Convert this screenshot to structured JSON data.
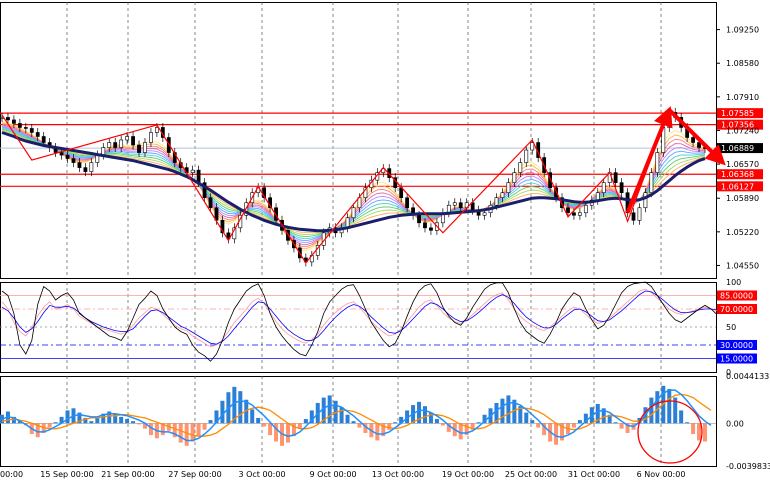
{
  "colors": {
    "background": "#ffffff",
    "level_line": "#ff0000",
    "current_price_line": "#b0c4de",
    "ma_thick": "#1a1f6b",
    "osc_blue": "#1e90ff",
    "osc_orange": "#ff8c00",
    "hist_positive": "#2b7fd4",
    "hist_negative": "#ff9470",
    "stoch_upper": "#ff9999",
    "stoch_lower": "#0000ff"
  },
  "chart_data": [
    {
      "type": "line",
      "panel": "price",
      "y_ticks": [
        "1.09250",
        "1.08580",
        "1.07910",
        "1.07240",
        "1.06570",
        "1.05890",
        "1.05220",
        "1.04550"
      ],
      "ylim": [
        1.043,
        1.098
      ],
      "x_ticks": [
        "00:00",
        "15 Sep 00:00",
        "21 Sep 00:00",
        "27 Sep 00:00",
        "3 Oct 00:00",
        "9 Oct 00:00",
        "13 Oct 00:00",
        "19 Oct 00:00",
        "25 Oct 00:00",
        "31 Oct 00:00",
        "6 Nov 00:00"
      ],
      "levels": [
        {
          "label": "1.07585",
          "value": 1.07585
        },
        {
          "label": "1.07356",
          "value": 1.07356
        },
        {
          "label": "1.06368",
          "value": 1.06368
        },
        {
          "label": "1.06127",
          "value": 1.06127
        }
      ],
      "current_price": {
        "label": "1.06889",
        "value": 1.06889
      },
      "close": [
        1.075,
        1.0745,
        1.0738,
        1.073,
        1.0728,
        1.072,
        1.0712,
        1.07,
        1.069,
        1.068,
        1.0675,
        1.0668,
        1.066,
        1.065,
        1.0642,
        1.066,
        1.0675,
        1.069,
        1.07,
        1.069,
        1.0705,
        1.0712,
        1.0695,
        1.068,
        1.07,
        1.072,
        1.073,
        1.071,
        1.068,
        1.066,
        1.065,
        1.064,
        1.0645,
        1.062,
        1.059,
        1.057,
        1.0545,
        1.052,
        1.0508,
        1.053,
        1.0555,
        1.058,
        1.06,
        1.061,
        1.059,
        1.057,
        1.0545,
        1.0525,
        1.0505,
        1.049,
        1.047,
        1.0462,
        1.0475,
        1.0495,
        1.052,
        1.053,
        1.052,
        1.053,
        1.055,
        1.057,
        1.059,
        1.061,
        1.0625,
        1.064,
        1.0648,
        1.063,
        1.061,
        1.059,
        1.057,
        1.0555,
        1.054,
        1.053,
        1.0525,
        1.054,
        1.056,
        1.0575,
        1.058,
        1.057,
        1.058,
        1.0565,
        1.0555,
        1.056,
        1.0575,
        1.059,
        1.06,
        1.062,
        1.064,
        1.066,
        1.0685,
        1.07,
        1.067,
        1.064,
        1.061,
        1.059,
        1.057,
        1.056,
        1.0555,
        1.056,
        1.0575,
        1.0585,
        1.06,
        1.062,
        1.064,
        1.062,
        1.06,
        1.056,
        1.0545,
        1.057,
        1.06,
        1.064,
        1.068,
        1.073,
        1.076,
        1.075,
        1.073,
        1.071,
        1.07,
        1.069,
        1.0688
      ],
      "ma_slow": [
        1.072,
        1.0716,
        1.0712,
        1.0707,
        1.0703,
        1.07,
        1.0697,
        1.0694,
        1.0692,
        1.069,
        1.0688,
        1.0686,
        1.0684,
        1.0682,
        1.068,
        1.0678,
        1.0676,
        1.0674,
        1.0672,
        1.067,
        1.0668,
        1.0666,
        1.0664,
        1.0661,
        1.0658,
        1.0655,
        1.0652,
        1.0649,
        1.0646,
        1.0642,
        1.0637,
        1.0632,
        1.0626,
        1.0619,
        1.0612,
        1.0605,
        1.0597,
        1.0589,
        1.0581,
        1.0574,
        1.0567,
        1.0561,
        1.0555,
        1.055,
        1.0545,
        1.0541,
        1.0537,
        1.0534,
        1.0531,
        1.0529,
        1.0527,
        1.0526,
        1.0525,
        1.0524,
        1.0524,
        1.0525,
        1.0526,
        1.0528,
        1.053,
        1.0533,
        1.0536,
        1.0539,
        1.0542,
        1.0545,
        1.0548,
        1.0551,
        1.0553,
        1.0555,
        1.0556,
        1.0557,
        1.0558,
        1.0558,
        1.0558,
        1.0558,
        1.0558,
        1.0559,
        1.056,
        1.0561,
        1.0562,
        1.0563,
        1.0564,
        1.0566,
        1.0568,
        1.0571,
        1.0574,
        1.0577,
        1.058,
        1.0583,
        1.0586,
        1.0589,
        1.059,
        1.059,
        1.0589,
        1.0588,
        1.0586,
        1.0584,
        1.0582,
        1.0581,
        1.0581,
        1.0582,
        1.0584,
        1.0586,
        1.0588,
        1.0589,
        1.0588,
        1.0586,
        1.0585,
        1.0586,
        1.059,
        1.0596,
        1.0604,
        1.0614,
        1.0624,
        1.0634,
        1.0643,
        1.0651,
        1.0658,
        1.0664,
        1.0668
      ],
      "zigzag": [
        [
          0,
          1.0755
        ],
        [
          5,
          1.0665
        ],
        [
          26,
          1.0735
        ],
        [
          38,
          1.0505
        ],
        [
          43,
          1.0612
        ],
        [
          51,
          1.046
        ],
        [
          64,
          1.065
        ],
        [
          74,
          1.052
        ],
        [
          89,
          1.0705
        ],
        [
          95,
          1.0552
        ],
        [
          102,
          1.064
        ],
        [
          105,
          1.0543
        ],
        [
          112,
          1.0765
        ],
        [
          118,
          1.069
        ]
      ],
      "arrows": [
        [
          [
            105,
            1.056
          ],
          [
            112,
            1.0765
          ]
        ],
        [
          [
            112,
            1.0765
          ],
          [
            121,
            1.066
          ]
        ]
      ]
    },
    {
      "type": "line",
      "panel": "stochastic",
      "y_ticks": [
        "100",
        "85.0000",
        "70.0000",
        "50",
        "30.0000",
        "15.0000",
        "0"
      ],
      "ylim": [
        0,
        100
      ],
      "levels": [
        85,
        70,
        50,
        30,
        15
      ],
      "series": [
        {
          "values": [
            78,
            70,
            55,
            45,
            40,
            50,
            62,
            72,
            78,
            70,
            72,
            75,
            70,
            62,
            58,
            54,
            50,
            48,
            46,
            44,
            42,
            45,
            52,
            60,
            66,
            72,
            70,
            64,
            58,
            52,
            48,
            46,
            40,
            36,
            32,
            28,
            30,
            36,
            45,
            55,
            62,
            70,
            78,
            82,
            76,
            66,
            56,
            48,
            42,
            38,
            34,
            32,
            36,
            42,
            52,
            60,
            66,
            72,
            76,
            78,
            72,
            64,
            56,
            50,
            44,
            40,
            42,
            48,
            56,
            64,
            72,
            78,
            80,
            74,
            66,
            60,
            56,
            54,
            58,
            64,
            70,
            76,
            82,
            86,
            88,
            80,
            70,
            62,
            56,
            52,
            48,
            46,
            50,
            56,
            62,
            68,
            72,
            70,
            64,
            58,
            54,
            56,
            60,
            66,
            72,
            78,
            84,
            90,
            92,
            88,
            82,
            76,
            70,
            66,
            64,
            66,
            68,
            70,
            72,
            70,
            68
          ]
        },
        {
          "values": [
            72,
            68,
            60,
            50,
            44,
            48,
            56,
            66,
            74,
            72,
            72,
            73,
            71,
            66,
            60,
            56,
            53,
            50,
            48,
            46,
            45,
            45,
            48,
            55,
            62,
            68,
            69,
            66,
            61,
            56,
            51,
            48,
            44,
            40,
            36,
            32,
            31,
            34,
            40,
            48,
            56,
            64,
            72,
            78,
            77,
            70,
            62,
            54,
            47,
            42,
            38,
            35,
            35,
            39,
            46,
            54,
            61,
            67,
            72,
            75,
            73,
            68,
            61,
            55,
            49,
            44,
            43,
            46,
            52,
            59,
            66,
            73,
            77,
            75,
            70,
            64,
            59,
            56,
            57,
            61,
            66,
            72,
            78,
            83,
            86,
            83,
            76,
            68,
            61,
            56,
            52,
            49,
            49,
            53,
            59,
            64,
            69,
            70,
            67,
            62,
            57,
            56,
            58,
            63,
            68,
            74,
            80,
            86,
            90,
            89,
            85,
            80,
            74,
            69,
            66,
            66,
            67,
            69,
            70,
            70,
            69
          ]
        },
        {
          "values": [
            90,
            85,
            65,
            30,
            20,
            35,
            75,
            95,
            90,
            80,
            85,
            88,
            80,
            65,
            60,
            55,
            50,
            45,
            40,
            38,
            35,
            45,
            60,
            75,
            82,
            90,
            85,
            70,
            60,
            50,
            45,
            42,
            30,
            22,
            18,
            12,
            20,
            35,
            55,
            70,
            80,
            90,
            95,
            98,
            85,
            65,
            50,
            40,
            32,
            25,
            20,
            18,
            30,
            45,
            65,
            78,
            85,
            92,
            96,
            97,
            85,
            70,
            55,
            45,
            35,
            28,
            32,
            45,
            62,
            78,
            90,
            96,
            98,
            88,
            72,
            62,
            55,
            52,
            60,
            72,
            82,
            92,
            97,
            99,
            99,
            88,
            70,
            55,
            45,
            40,
            35,
            32,
            42,
            55,
            70,
            80,
            88,
            84,
            70,
            58,
            48,
            52,
            62,
            75,
            88,
            95,
            98,
            99,
            100,
            95,
            85,
            75,
            65,
            58,
            55,
            60,
            65,
            70,
            74,
            70,
            64
          ]
        }
      ]
    },
    {
      "type": "bar",
      "panel": "oscillator",
      "y_ticks": [
        "0.0044133",
        "0.00",
        "-0.0039833"
      ],
      "ylim": [
        -0.0039833,
        0.0044133
      ],
      "histogram": [
        0.0008,
        0.0011,
        0.0006,
        0.0002,
        -0.0002,
        -0.001,
        -0.0013,
        -0.0009,
        -0.0004,
        0.0001,
        0.0006,
        0.0012,
        0.0014,
        0.001,
        0.0005,
        0.0002,
        0.0005,
        0.0009,
        0.0011,
        0.0009,
        0.0006,
        0.0004,
        0.0002,
        -0.0001,
        -0.0005,
        -0.0011,
        -0.0014,
        -0.0011,
        -0.0007,
        -0.0013,
        -0.0018,
        -0.0021,
        -0.0017,
        -0.0012,
        -0.0006,
        0.0003,
        0.0012,
        0.0021,
        0.0029,
        0.0034,
        0.003,
        0.0022,
        0.0013,
        0.0005,
        -0.0003,
        -0.0011,
        -0.0017,
        -0.0021,
        -0.0018,
        -0.0012,
        -0.0005,
        0.0004,
        0.0012,
        0.0019,
        0.0024,
        0.0026,
        0.0021,
        0.0015,
        0.0008,
        0.0002,
        -0.0004,
        -0.0009,
        -0.0013,
        -0.0016,
        -0.0012,
        -0.0006,
        0.0001,
        0.0006,
        0.0012,
        0.0017,
        0.002,
        0.0016,
        0.001,
        0.0004,
        -0.0002,
        -0.0008,
        -0.0012,
        -0.0015,
        -0.0011,
        -0.0006,
        0.0001,
        0.0008,
        0.0014,
        0.0019,
        0.0023,
        0.0026,
        0.0022,
        0.0016,
        0.001,
        0.0003,
        -0.0004,
        -0.0011,
        -0.0017,
        -0.002,
        -0.0016,
        -0.001,
        -0.0004,
        0.0003,
        0.0009,
        0.0015,
        0.0018,
        0.0014,
        0.0008,
        0.0001,
        -0.0005,
        -0.0009,
        -0.0006,
        0.0005,
        0.0015,
        0.0024,
        0.003,
        0.0035,
        0.0032,
        0.0024,
        0.0012,
        0.0001,
        -0.001,
        -0.0016,
        -0.0017
      ],
      "series": [
        {
          "values": [
            0.0004,
            0.0006,
            0.0005,
            0.0002,
            -0.0001,
            -0.0005,
            -0.0008,
            -0.0008,
            -0.0006,
            -0.0003,
            0.0,
            0.0004,
            0.0007,
            0.0008,
            0.0007,
            0.0006,
            0.0006,
            0.0008,
            0.0009,
            0.0009,
            0.0008,
            0.0007,
            0.0005,
            0.0003,
            0.0,
            -0.0004,
            -0.0007,
            -0.0008,
            -0.0008,
            -0.001,
            -0.0013,
            -0.0016,
            -0.0016,
            -0.0014,
            -0.001,
            -0.0005,
            0.0001,
            0.0008,
            0.0014,
            0.0019,
            0.0021,
            0.002,
            0.0017,
            0.0012,
            0.0007,
            0.0001,
            -0.0005,
            -0.001,
            -0.0012,
            -0.0011,
            -0.0008,
            -0.0003,
            0.0003,
            0.0009,
            0.0014,
            0.0017,
            0.0017,
            0.0015,
            0.0011,
            0.0007,
            0.0002,
            -0.0003,
            -0.0007,
            -0.001,
            -0.001,
            -0.0008,
            -0.0004,
            0.0,
            0.0005,
            0.0009,
            0.0012,
            0.0012,
            0.001,
            0.0007,
            0.0003,
            -0.0002,
            -0.0006,
            -0.0009,
            -0.0009,
            -0.0007,
            -0.0003,
            0.0002,
            0.0007,
            0.0012,
            0.0016,
            0.0019,
            0.0019,
            0.0017,
            0.0013,
            0.0008,
            0.0003,
            -0.0003,
            -0.0008,
            -0.0012,
            -0.0013,
            -0.0011,
            -0.0008,
            -0.0003,
            0.0002,
            0.0007,
            0.0011,
            0.0012,
            0.001,
            0.0006,
            0.0002,
            -0.0002,
            -0.0003,
            0.0001,
            0.0008,
            0.0015,
            0.0022,
            0.0028,
            0.0031,
            0.0031,
            0.0027,
            0.0021,
            0.0014,
            0.0007,
            0.0002,
            -0.0002
          ]
        },
        {
          "values": [
            0.0002,
            0.0003,
            0.0004,
            0.0003,
            0.0002,
            0.0,
            -0.0002,
            -0.0004,
            -0.0005,
            -0.0005,
            -0.0004,
            -0.0002,
            0.0,
            0.0002,
            0.0004,
            0.0005,
            0.0005,
            0.0006,
            0.0007,
            0.0007,
            0.0008,
            0.0008,
            0.0007,
            0.0006,
            0.0005,
            0.0003,
            0.0001,
            -0.0001,
            -0.0003,
            -0.0005,
            -0.0007,
            -0.0009,
            -0.0011,
            -0.0012,
            -0.0012,
            -0.0011,
            -0.0009,
            -0.0005,
            -0.0001,
            0.0004,
            0.0008,
            0.0012,
            0.0014,
            0.0015,
            0.0014,
            0.0012,
            0.0008,
            0.0004,
            0.0,
            -0.0003,
            -0.0005,
            -0.0005,
            -0.0004,
            -0.0001,
            0.0003,
            0.0007,
            0.001,
            0.0012,
            0.0012,
            0.0011,
            0.0009,
            0.0006,
            0.0003,
            0.0,
            -0.0003,
            -0.0004,
            -0.0005,
            -0.0004,
            -0.0002,
            0.0001,
            0.0004,
            0.0006,
            0.0008,
            0.0008,
            0.0007,
            0.0005,
            0.0002,
            -0.0001,
            -0.0003,
            -0.0005,
            -0.0005,
            -0.0004,
            -0.0001,
            0.0002,
            0.0006,
            0.0009,
            0.0012,
            0.0014,
            0.0014,
            0.0013,
            0.0011,
            0.0008,
            0.0004,
            0.0,
            -0.0003,
            -0.0005,
            -0.0006,
            -0.0005,
            -0.0003,
            0.0,
            0.0003,
            0.0006,
            0.0007,
            0.0007,
            0.0006,
            0.0004,
            0.0002,
            0.0002,
            0.0004,
            0.0008,
            0.0013,
            0.0018,
            0.0023,
            0.0026,
            0.0027,
            0.0026,
            0.0024,
            0.002,
            0.0016,
            0.0012
          ]
        }
      ]
    }
  ]
}
